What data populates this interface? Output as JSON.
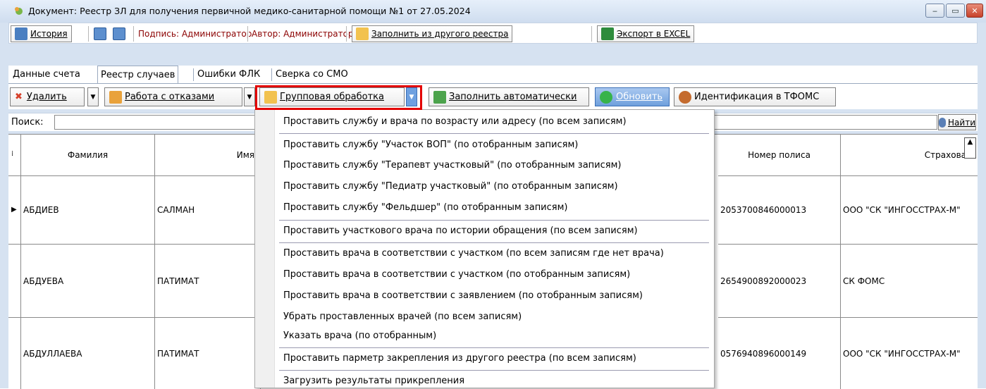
{
  "window": {
    "title": "Документ: Реестр ЗЛ для получения первичной медико-санитарной помощи №1 от 27.05.2024",
    "minimize": "‒",
    "maximize": "▭",
    "close": "✕"
  },
  "toolbar1": {
    "history": "История",
    "signature": "Подпись: Администратор",
    "author": "Автор: Администратор",
    "fill_from_other": "Заполнить из другого реестра",
    "export_excel": "Экспорт в EXCEL"
  },
  "tabs": [
    "Данные счета",
    "Реестр случаев",
    "Ошибки ФЛК",
    "Сверка со СМО"
  ],
  "toolbar2": {
    "delete": "Удалить",
    "work_refusals": "Работа с отказами",
    "group_processing": "Групповая обработка",
    "fill_auto": "Заполнить автоматически",
    "refresh": "Обновить",
    "identify": "Идентификация в ТФОМС"
  },
  "search": {
    "label": "Поиск:",
    "value": "",
    "find": "Найти"
  },
  "grid": {
    "columns": {
      "surname": "Фамилия",
      "name": "Имя",
      "policy": "Номер полиса",
      "insurer": "Страхова"
    },
    "rows": [
      {
        "surname": "АБДИЕВ",
        "name": "САЛМАН",
        "policy": "2053700846000013",
        "insurer": "ООО \"СК \"ИНГОССТРАХ-М\""
      },
      {
        "surname": "АБДУЕВА",
        "name": "ПАТИМАТ",
        "policy": "2654900892000023",
        "insurer": "СК ФОМС"
      },
      {
        "surname": "АБДУЛЛАЕВА",
        "name": "ПАТИМАТ",
        "policy": "0576940896000149",
        "insurer": "ООО \"СК \"ИНГОССТРАХ-М\""
      }
    ]
  },
  "menu": {
    "items": [
      "Проставить службу и врача по возрасту или адресу (по всем записям)",
      "Проставить службу \"Участок ВОП\" (по отобранным записям)",
      "Проставить службу \"Терапевт участковый\" (по отобранным записям)",
      "Проставить службу \"Педиатр участковый\" (по отобранным записям)",
      "Проставить службу \"Фельдшер\" (по отобранным записям)",
      "Проставить участкового врача по истории обращения (по всем записям)",
      "Проставить врача в соответствии с участком (по всем записям где нет врача)",
      "Проставить врача в соответствии с участком (по отобранным записям)",
      "Проставить врача в соответствии с заявлением (по отобранным записям)",
      "Убрать проставленных врачей (по всем записям)",
      "Указать врача (по отобранным)",
      "Проставить парметр закрепления из другого реестра (по всем записям)",
      "Загрузить результаты прикрепления"
    ]
  },
  "colors": {
    "highlight": "#e30000",
    "author_text": "#8b0000",
    "signature_text": "#8b0000"
  }
}
